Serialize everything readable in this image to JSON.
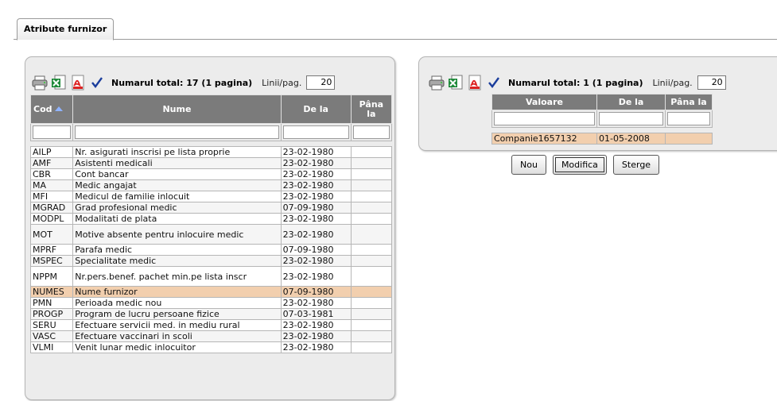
{
  "tabs": [
    {
      "label": "Atribute furnizor"
    }
  ],
  "left": {
    "total_label": "Numarul total: 17 (1 pagina)",
    "per_page_label": "Linii/pag.",
    "per_page_value": "20",
    "columns": [
      "Cod",
      "Nume",
      "De la",
      "Pâna la"
    ],
    "rows": [
      {
        "cod": "AILP",
        "nume": "Nr. asigurati inscrisi pe lista proprie",
        "dela": "23-02-1980",
        "panala": ""
      },
      {
        "cod": "AMF",
        "nume": "Asistenti medicali",
        "dela": "23-02-1980",
        "panala": ""
      },
      {
        "cod": "CBR",
        "nume": "Cont bancar",
        "dela": "23-02-1980",
        "panala": ""
      },
      {
        "cod": "MA",
        "nume": "Medic angajat",
        "dela": "23-02-1980",
        "panala": ""
      },
      {
        "cod": "MFI",
        "nume": "Medicul de familie inlocuit",
        "dela": "23-02-1980",
        "panala": ""
      },
      {
        "cod": "MGRAD",
        "nume": "Grad profesional medic",
        "dela": "07-09-1980",
        "panala": ""
      },
      {
        "cod": "MODPL",
        "nume": "Modalitati de plata",
        "dela": "23-02-1980",
        "panala": ""
      },
      {
        "cod": "MOT",
        "nume": "Motive absente pentru inlocuire medic",
        "dela": "23-02-1980",
        "panala": ""
      },
      {
        "cod": "MPRF",
        "nume": "Parafa medic",
        "dela": "07-09-1980",
        "panala": ""
      },
      {
        "cod": "MSPEC",
        "nume": "Specialitate medic",
        "dela": "23-02-1980",
        "panala": ""
      },
      {
        "cod": "NPPM",
        "nume": "Nr.pers.benef. pachet min.pe lista inscr",
        "dela": "23-02-1980",
        "panala": ""
      },
      {
        "cod": "NUMES",
        "nume": "Nume furnizor",
        "dela": "07-09-1980",
        "panala": ""
      },
      {
        "cod": "PMN",
        "nume": "Perioada medic nou",
        "dela": "23-02-1980",
        "panala": ""
      },
      {
        "cod": "PROGP",
        "nume": "Program de lucru persoane fizice",
        "dela": "07-03-1981",
        "panala": ""
      },
      {
        "cod": "SERU",
        "nume": "Efectuare servicii med. in mediu rural",
        "dela": "23-02-1980",
        "panala": ""
      },
      {
        "cod": "VASC",
        "nume": "Efectuare vaccinari in scoli",
        "dela": "23-02-1980",
        "panala": ""
      },
      {
        "cod": "VLMI",
        "nume": "Venit lunar medic inlocuitor",
        "dela": "23-02-1980",
        "panala": ""
      }
    ]
  },
  "right": {
    "total_label": "Numarul total: 1 (1 pagina)",
    "per_page_label": "Linii/pag.",
    "per_page_value": "20",
    "columns": [
      "Valoare",
      "De la",
      "Pâna la"
    ],
    "rows": [
      {
        "valoare": "Companie1657132",
        "dela": "01-05-2008",
        "panala": ""
      }
    ]
  },
  "buttons": {
    "nou": "Nou",
    "modifica": "Modifica",
    "sterge": "Sterge"
  },
  "colors": {
    "header_bg": "#7b7b7b",
    "selected_row": "#f2cfae",
    "panel_bg": "#ececec"
  },
  "icons": [
    "printer-icon",
    "excel-icon",
    "pdf-icon",
    "checkmark-icon"
  ]
}
